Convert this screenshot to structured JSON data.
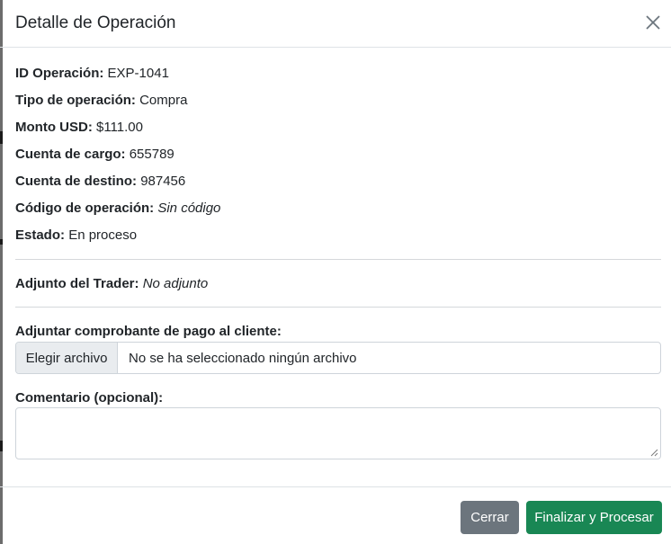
{
  "modal": {
    "title": "Detalle de Operación"
  },
  "details": [
    {
      "label": "ID Operación:",
      "value": "EXP-1041",
      "italic": false
    },
    {
      "label": "Tipo de operación:",
      "value": "Compra",
      "italic": false
    },
    {
      "label": "Monto USD:",
      "value": "$111.00",
      "italic": false
    },
    {
      "label": "Cuenta de cargo:",
      "value": "655789",
      "italic": false
    },
    {
      "label": "Cuenta de destino:",
      "value": "987456",
      "italic": false
    },
    {
      "label": "Código de operación:",
      "value": "Sin código",
      "italic": true
    },
    {
      "label": "Estado:",
      "value": "En proceso",
      "italic": false
    }
  ],
  "trader_attachment": {
    "label": "Adjunto del Trader:",
    "value": "No adjunto"
  },
  "upload": {
    "label": "Adjuntar comprobante de pago al cliente:",
    "button_label": "Elegir archivo",
    "status": "No se ha seleccionado ningún archivo"
  },
  "comment": {
    "label": "Comentario (opcional):",
    "value": ""
  },
  "footer": {
    "close_label": "Cerrar",
    "submit_label": "Finalizar y Procesar"
  },
  "colors": {
    "close_button": "#6c757d",
    "submit_button": "#198754"
  },
  "icons": {
    "close": "close-icon",
    "resize": "resize-grip-icon"
  }
}
